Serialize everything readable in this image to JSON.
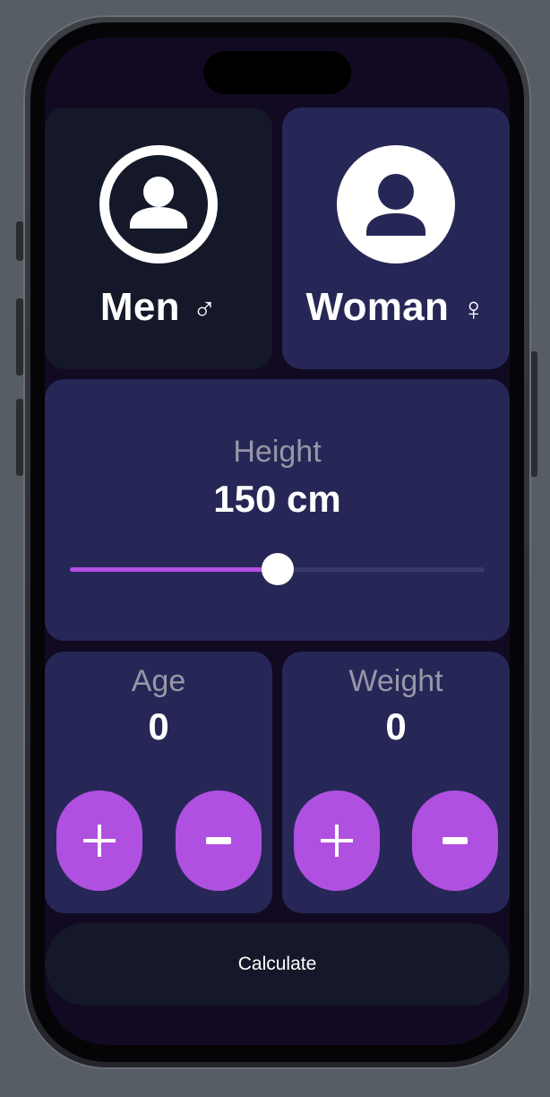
{
  "gender": {
    "men": {
      "label": "Men",
      "symbol": "♂",
      "icon": "person-circle-outline-icon"
    },
    "woman": {
      "label": "Woman",
      "symbol": "♀",
      "icon": "person-circle-filled-icon"
    }
  },
  "height": {
    "label": "Height",
    "value_text": "150 cm",
    "slider_fraction": 0.5
  },
  "age": {
    "label": "Age",
    "value": "0",
    "plus_icon": "plus-icon",
    "minus_icon": "minus-icon"
  },
  "weight": {
    "label": "Weight",
    "value": "0",
    "plus_icon": "plus-icon",
    "minus_icon": "minus-icon"
  },
  "calculate_label": "Calculate",
  "colors": {
    "background": "#120a22",
    "card_selected": "#262756",
    "card_unselected": "#151828",
    "accent": "#b050e0",
    "text_secondary": "#9698a8"
  }
}
